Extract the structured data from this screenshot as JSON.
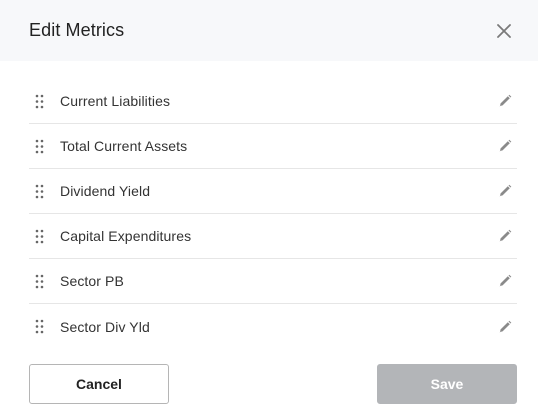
{
  "dialog": {
    "title": "Edit Metrics",
    "close_icon": "close-icon"
  },
  "metrics": [
    {
      "label": "Current Liabilities"
    },
    {
      "label": "Total Current Assets"
    },
    {
      "label": "Dividend Yield"
    },
    {
      "label": "Capital Expenditures"
    },
    {
      "label": "Sector PB"
    },
    {
      "label": "Sector Div Yld"
    }
  ],
  "icons": {
    "drag": "drag-handle-icon",
    "edit": "pencil-icon"
  },
  "footer": {
    "cancel_label": "Cancel",
    "save_label": "Save",
    "save_disabled": true
  },
  "colors": {
    "header_bg": "#f7f8fa",
    "divider": "#e6e6e6",
    "save_disabled_bg": "#b3b5b8",
    "icon_gray": "#8a8a8a"
  }
}
